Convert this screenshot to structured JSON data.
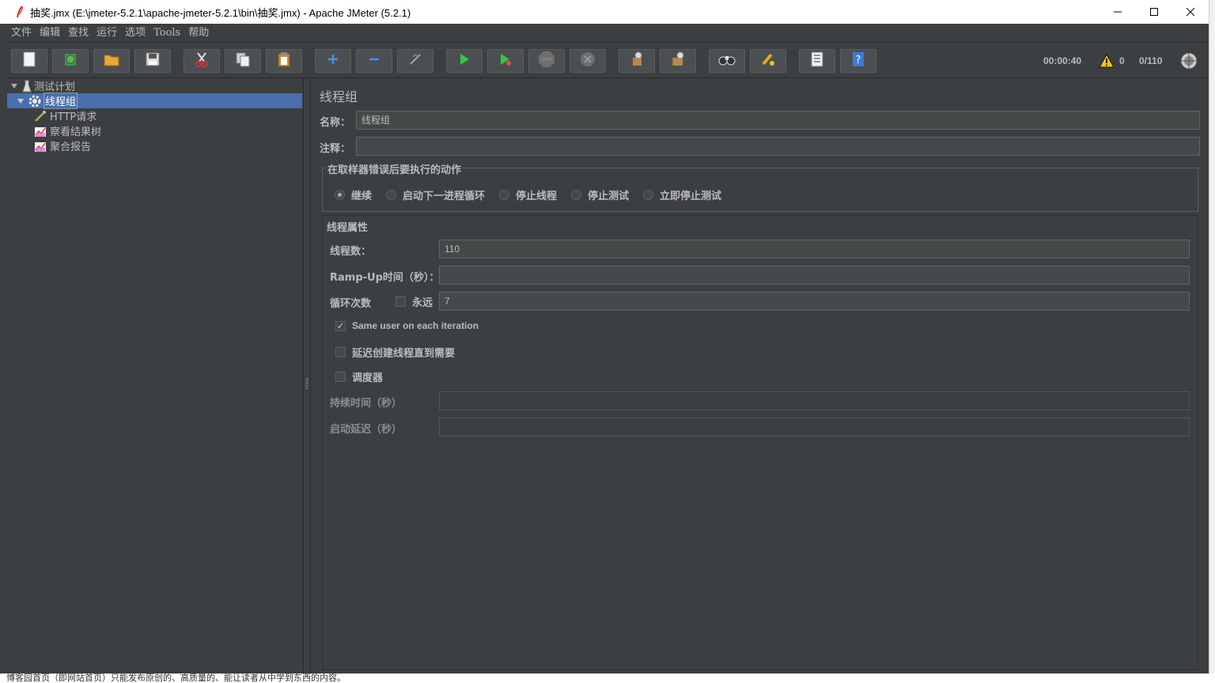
{
  "window": {
    "title": "抽奖.jmx (E:\\jmeter-5.2.1\\apache-jmeter-5.2.1\\bin\\抽奖.jmx) - Apache JMeter (5.2.1)"
  },
  "menu": [
    "文件",
    "编辑",
    "查找",
    "运行",
    "选项",
    "Tools",
    "帮助"
  ],
  "toolbar": {
    "buttons": [
      "new-icon",
      "templates-icon",
      "open-icon",
      "save-icon",
      "cut-icon",
      "copy-icon",
      "paste-icon",
      "expand-icon",
      "collapse-icon",
      "toggle-icon",
      "start-icon",
      "start-no-pause-icon",
      "stop-icon",
      "shutdown-icon",
      "clear-icon",
      "clear-all-icon",
      "search-icon",
      "reset-search-icon",
      "function-helper-icon",
      "help-icon"
    ],
    "elapsed": "00:00:40",
    "warnings": "0",
    "threads": "0/110"
  },
  "tree": {
    "items": [
      {
        "label": "测试计划"
      },
      {
        "label": "线程组"
      },
      {
        "label": "HTTP请求"
      },
      {
        "label": "察看结果树"
      },
      {
        "label": "聚合报告"
      }
    ]
  },
  "form": {
    "heading": "线程组",
    "name_label": "名称：",
    "name_value": "线程组",
    "comment_label": "注释：",
    "comment_value": "",
    "error_action": {
      "title": "在取样器错误后要执行的动作",
      "options": [
        "继续",
        "启动下一进程循环",
        "停止线程",
        "停止测试",
        "立即停止测试"
      ],
      "selected": "继续"
    },
    "thread_props": {
      "title": "线程属性",
      "threads_label": "线程数：",
      "threads_value": "110",
      "rampup_label": "Ramp-Up时间（秒）：",
      "rampup_value": "",
      "loop_label": "循环次数",
      "forever_label": "永远",
      "loop_value": "7",
      "same_user_label": "Same user on each iteration",
      "delay_label": "延迟创建线程直到需要",
      "scheduler_label": "调度器",
      "duration_label": "持续时间（秒）",
      "duration_value": "",
      "startup_delay_label": "启动延迟（秒）",
      "startup_delay_value": ""
    }
  },
  "background_text": "博客园首页（即网站首页）只能发布原创的、高质量的、能让读者从中学到东西的内容。"
}
